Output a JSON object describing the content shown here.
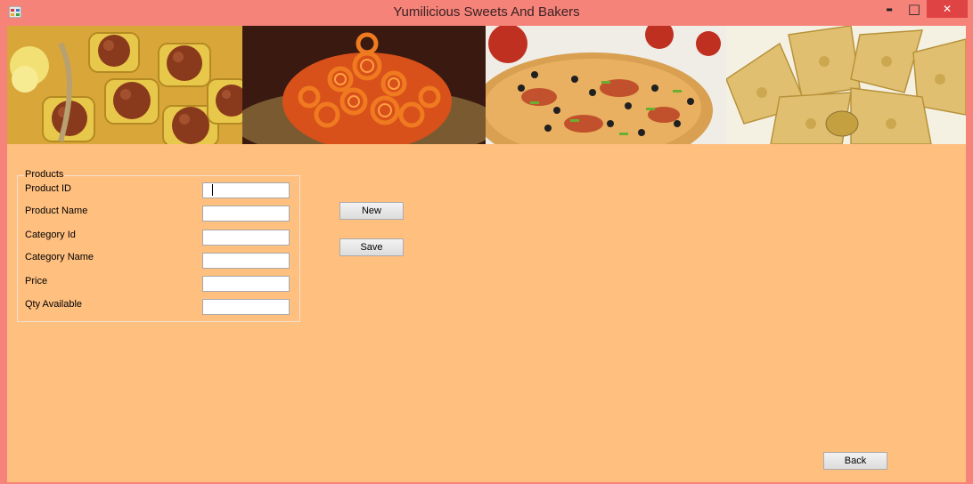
{
  "window": {
    "title": "Yumilicious Sweets And Bakers",
    "controls": {
      "minimize": "▬",
      "maximize": "□",
      "close": "✕"
    }
  },
  "banner": {
    "images": [
      "gulab-jamun-image",
      "jalebi-image",
      "pizza-image",
      "samosa-image"
    ]
  },
  "products": {
    "group_label": "Products",
    "fields": [
      {
        "label": "Product ID",
        "value": ""
      },
      {
        "label": "Product Name",
        "value": ""
      },
      {
        "label": "Category Id",
        "value": ""
      },
      {
        "label": "Category Name",
        "value": ""
      },
      {
        "label": "Price",
        "value": ""
      },
      {
        "label": "Qty Available",
        "value": ""
      }
    ]
  },
  "buttons": {
    "new": "New",
    "save": "Save",
    "back": "Back"
  },
  "colors": {
    "titlebar": "#f5837a",
    "form_background": "#ffbf7f",
    "close_button": "#e04343"
  }
}
